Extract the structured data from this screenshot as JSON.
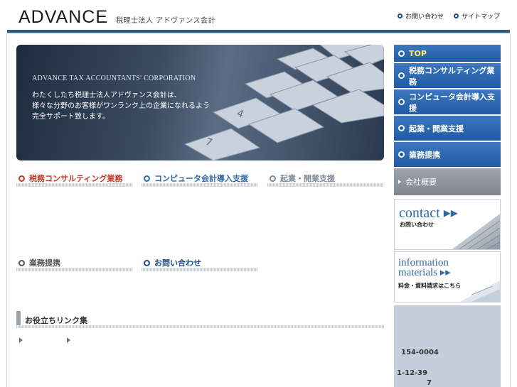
{
  "header": {
    "logo": "ADVANCE",
    "logo_sub": "税理士法人 アドヴァンス会計",
    "links": [
      {
        "label": "お問い合わせ"
      },
      {
        "label": "サイトマップ"
      }
    ]
  },
  "hero": {
    "english": "ADVANCE TAX ACCOUNTANTS' CORPORATION",
    "lines": [
      "わたくしたち税理士法人アドヴァンス会計は、",
      "様々な分野のお客様がワンランク上の企業になれるよう",
      "完全サポート致します。"
    ]
  },
  "sections": {
    "consulting": {
      "label": "税務コンサルティング業務",
      "color": "#c0392b"
    },
    "computer": {
      "label": "コンピュータ会計導入支援",
      "color": "#2f6aa6"
    },
    "startup": {
      "label": "起業・開業支援",
      "color": "#7d8a99"
    },
    "partnership": {
      "label": "業務提携",
      "color": "#555555"
    },
    "contact": {
      "label": "お問い合わせ",
      "color": "#1c4a8a"
    }
  },
  "links_section": {
    "title": "お役立ちリンク集"
  },
  "nav": {
    "top": "TOP",
    "items": [
      {
        "label": "税務コンサルティング業務"
      },
      {
        "label": "コンピュータ会計導入支援"
      },
      {
        "label": "起業・開業支援"
      },
      {
        "label": "業務提携"
      }
    ],
    "company": "会社概要"
  },
  "contact_box": {
    "big": "contact ▸▸",
    "small": "お問い合わせ"
  },
  "info_box": {
    "line1": "information",
    "line2": "materials ▸▸",
    "small": "料金・資料請求はこちら"
  },
  "address": {
    "postal": "154-0004",
    "street": "1-12-39",
    "building": "7"
  }
}
